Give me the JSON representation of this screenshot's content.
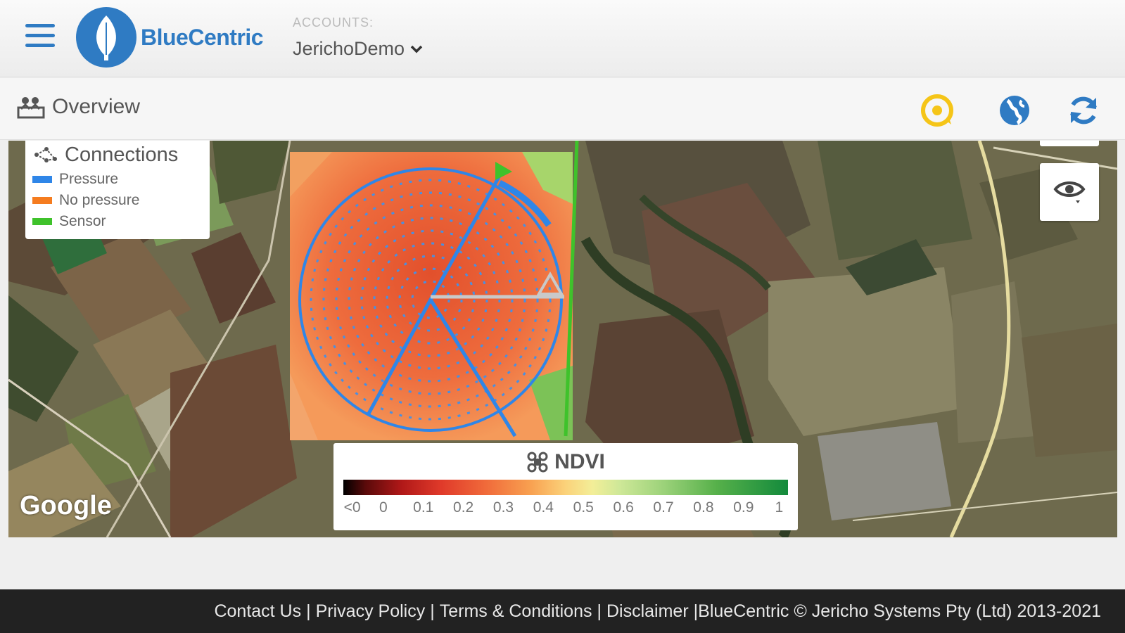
{
  "header": {
    "brand": "BlueCentric",
    "accounts_label": "ACCOUNTS:",
    "account_selected": "JerichoDemo"
  },
  "subheader": {
    "title": "Overview"
  },
  "legend": {
    "title": "Connections",
    "items": [
      {
        "label": "Pressure",
        "color": "#2f86e8"
      },
      {
        "label": "No pressure",
        "color": "#f57c1f"
      },
      {
        "label": "Sensor",
        "color": "#3fc22b"
      }
    ]
  },
  "map": {
    "attribution": "Google"
  },
  "ndvi": {
    "title": "NDVI",
    "ticks": [
      "<0",
      "0",
      "0.1",
      "0.2",
      "0.3",
      "0.4",
      "0.5",
      "0.6",
      "0.7",
      "0.8",
      "0.9",
      "1"
    ]
  },
  "footer": {
    "contact": "Contact Us",
    "privacy": "Privacy Policy",
    "terms": "Terms & Conditions",
    "disclaimer": "Disclaimer",
    "copyright": "BlueCentric © Jericho Systems Pty (Ltd) 2013-2021"
  },
  "colors": {
    "brand_blue": "#2f7bc3",
    "accent_yellow": "#f5c518"
  },
  "icons": [
    "menu-icon",
    "chevron-down-icon",
    "map-people-icon",
    "location-refresh-icon",
    "globe-icon",
    "refresh-icon",
    "connections-icon",
    "eye-icon",
    "drone-icon"
  ]
}
